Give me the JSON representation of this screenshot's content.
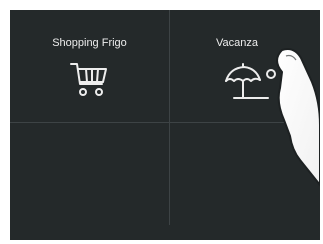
{
  "tiles": [
    {
      "label": "Shopping Frigo",
      "icon": "shopping-cart-icon"
    },
    {
      "label": "Vacanza",
      "icon": "beach-umbrella-sun-icon"
    },
    {
      "label": "",
      "icon": ""
    },
    {
      "label": "",
      "icon": ""
    }
  ],
  "colors": {
    "background": "#24292a",
    "divider": "#3d4345",
    "foreground": "#ededed"
  }
}
